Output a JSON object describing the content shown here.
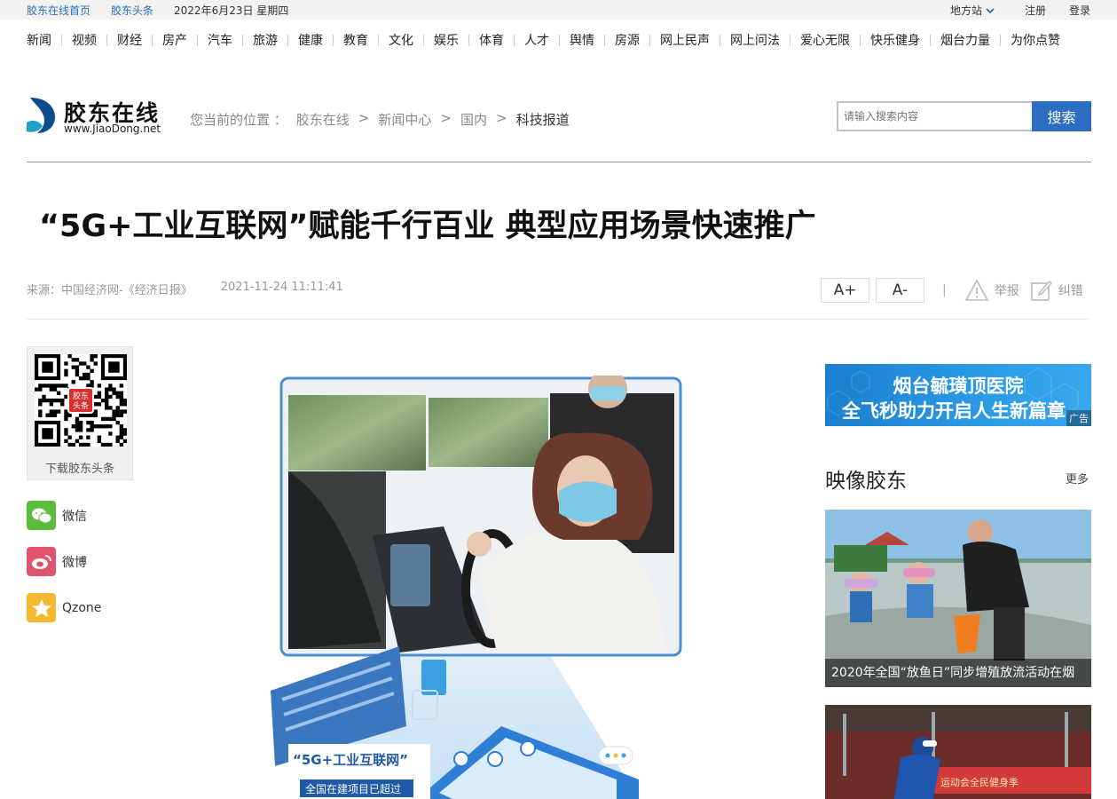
{
  "topbar": {
    "home_link": "胶东在线首页",
    "headline_link": "胶东头条",
    "date": "2022年6月23日 星期四",
    "local_sites": "地方站",
    "register": "注册",
    "login": "登录"
  },
  "nav": {
    "items": [
      "新闻",
      "视频",
      "财经",
      "房产",
      "汽车",
      "旅游",
      "健康",
      "教育",
      "文化",
      "娱乐",
      "体育",
      "人才",
      "舆情",
      "房源",
      "网上民声",
      "网上问法",
      "爱心无限",
      "快乐健身",
      "烟台力量",
      "为你点赞"
    ]
  },
  "header": {
    "logo_name": "胶东在线",
    "logo_url": "www.JiaoDong.net",
    "breadcrumb_prefix": "您当前的位置 ：",
    "breadcrumb": [
      "胶东在线",
      "新闻中心",
      "国内",
      "科技报道"
    ],
    "breadcrumb_sep": ">",
    "search_placeholder": "请输入搜索内容",
    "search_button": "搜索"
  },
  "article": {
    "title": "“5G+工业互联网”赋能千行百业 典型应用场景快速推广",
    "source": "来源：中国经济网-《经济日报》",
    "datetime": "2021-11-24 11:11:41",
    "font_increase": "A+",
    "font_decrease": "A-",
    "separator": "|",
    "report": "举报",
    "correct": "纠错",
    "image_caption_title": "“5G+工业互联网”",
    "image_caption_sub": "全国在建项目已超过"
  },
  "share": {
    "qr_label": "下载胶东头条",
    "qr_badge": "胶东\n头条",
    "wechat": "微信",
    "weibo": "微博",
    "qzone": "Qzone"
  },
  "sidebar": {
    "ad_line1": "烟台毓璜顶医院",
    "ad_line2": "全飞秒助力开启人生新篇章",
    "ad_tag": "广告",
    "section_title": "映像胶东",
    "more": "更多",
    "photo1_caption": "2020年全国“放鱼日”同步增殖放流活动在烟",
    "photo2_banner": "运动会全民健身季"
  },
  "colors": {
    "link_blue": "#2b6fb5",
    "search_button": "#2d6dc3",
    "divider": "#7fa3b7",
    "wechat_green": "#5cbd3c",
    "weibo_red": "#e0556d",
    "qzone_yellow": "#f5b82e"
  }
}
